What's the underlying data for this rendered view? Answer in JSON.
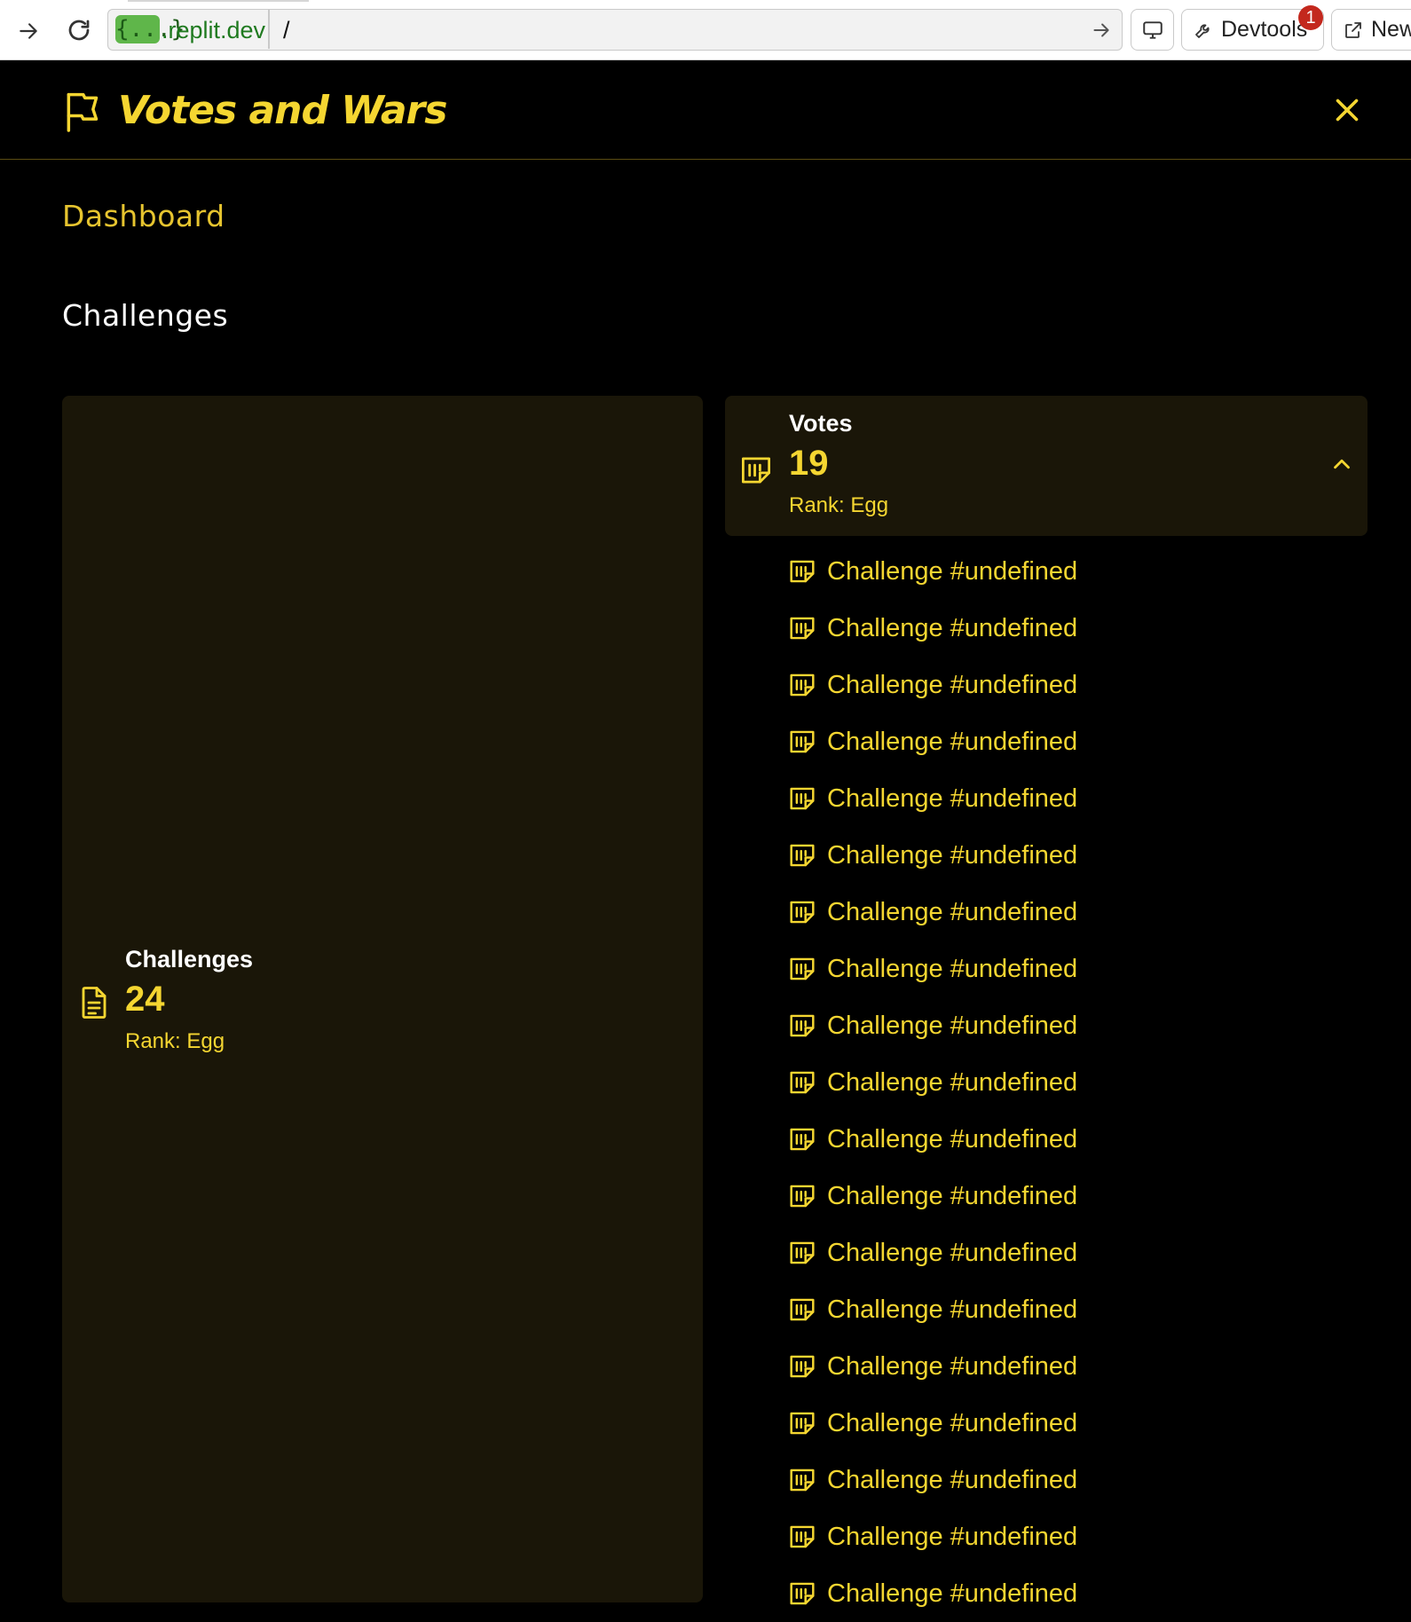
{
  "browser": {
    "url_chip": "{...}",
    "url_domain": ".replit.dev",
    "url_path": "/",
    "devtools_label": "Devtools",
    "devtools_badge": "1",
    "newtab_label": "New"
  },
  "header": {
    "title": "Votes and Wars"
  },
  "nav": {
    "dashboard": "Dashboard",
    "challenges": "Challenges"
  },
  "challenges_card": {
    "label": "Challenges",
    "value": "24",
    "rank": "Rank: Egg"
  },
  "votes_card": {
    "label": "Votes",
    "value": "19",
    "rank": "Rank: Egg"
  },
  "vote_items": [
    "Challenge #undefined",
    "Challenge #undefined",
    "Challenge #undefined",
    "Challenge #undefined",
    "Challenge #undefined",
    "Challenge #undefined",
    "Challenge #undefined",
    "Challenge #undefined",
    "Challenge #undefined",
    "Challenge #undefined",
    "Challenge #undefined",
    "Challenge #undefined",
    "Challenge #undefined",
    "Challenge #undefined",
    "Challenge #undefined",
    "Challenge #undefined",
    "Challenge #undefined",
    "Challenge #undefined",
    "Challenge #undefined"
  ],
  "colors": {
    "accent": "#f5d631",
    "background": "#000000",
    "card": "#1a1608"
  }
}
